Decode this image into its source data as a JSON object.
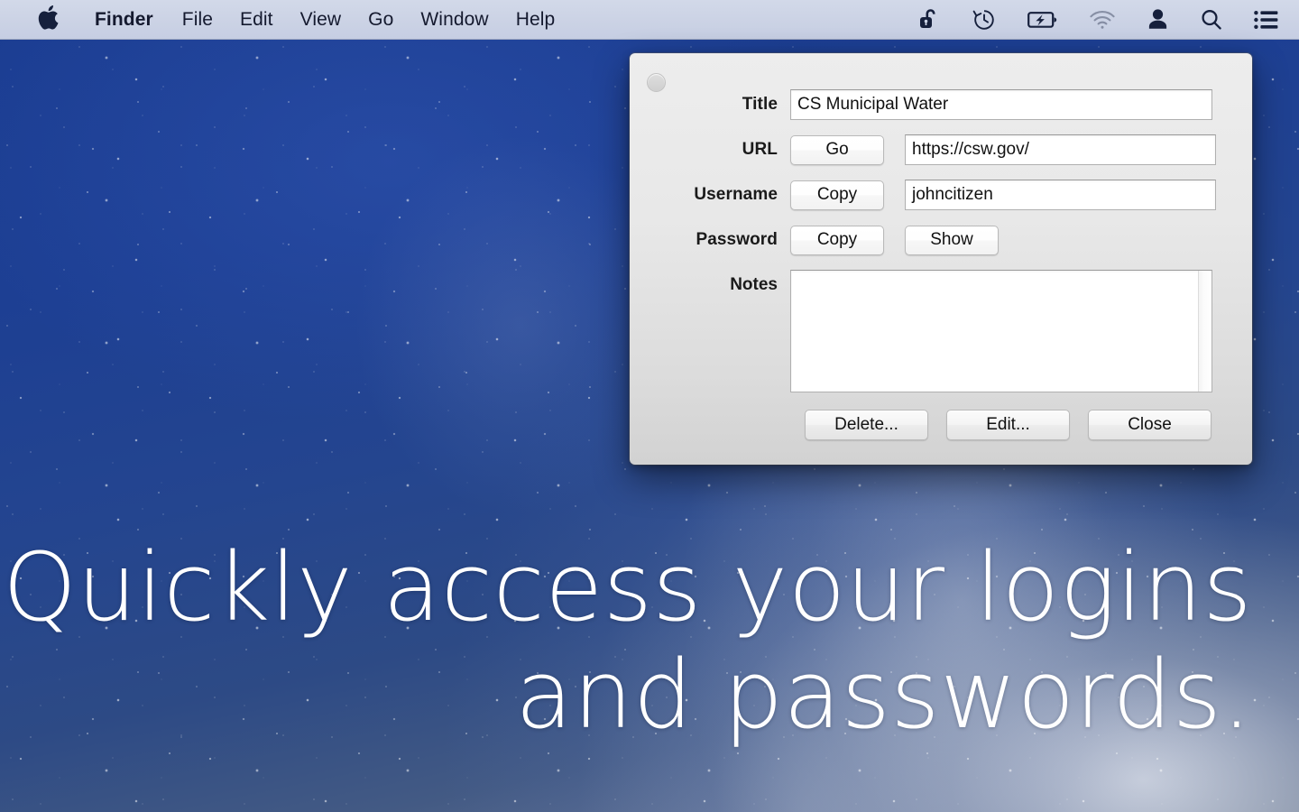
{
  "menubar": {
    "apple_logo": "apple-logo",
    "items": [
      {
        "label": "Finder",
        "bold": true
      },
      {
        "label": "File",
        "bold": false
      },
      {
        "label": "Edit",
        "bold": false
      },
      {
        "label": "View",
        "bold": false
      },
      {
        "label": "Go",
        "bold": false
      },
      {
        "label": "Window",
        "bold": false
      },
      {
        "label": "Help",
        "bold": false
      }
    ],
    "status_icons": [
      "padlock-open-icon",
      "time-machine-icon",
      "battery-charging-icon",
      "wifi-icon",
      "user-account-icon",
      "spotlight-search-icon",
      "notification-center-icon"
    ]
  },
  "dialog": {
    "close_button": "close-window-button",
    "fields": {
      "title": {
        "label": "Title",
        "value": "CS Municipal Water"
      },
      "url": {
        "label": "URL",
        "button": "Go",
        "value": "https://csw.gov/"
      },
      "username": {
        "label": "Username",
        "button": "Copy",
        "value": "johncitizen"
      },
      "password": {
        "label": "Password",
        "copy_button": "Copy",
        "show_button": "Show"
      },
      "notes": {
        "label": "Notes",
        "value": "",
        "placeholder": ""
      }
    },
    "actions": {
      "delete": "Delete...",
      "edit": "Edit...",
      "close": "Close"
    }
  },
  "wallpaper": {
    "tagline_line1": "Quickly access your logins",
    "tagline_line2": "and passwords."
  },
  "colors": {
    "menubar_bg": "#ccd4e6",
    "desktop_blue": "#1b3d92",
    "dialog_bg": "#e8e8e8",
    "text_dark": "#1a1a1a",
    "tagline_white": "#ffffff"
  }
}
